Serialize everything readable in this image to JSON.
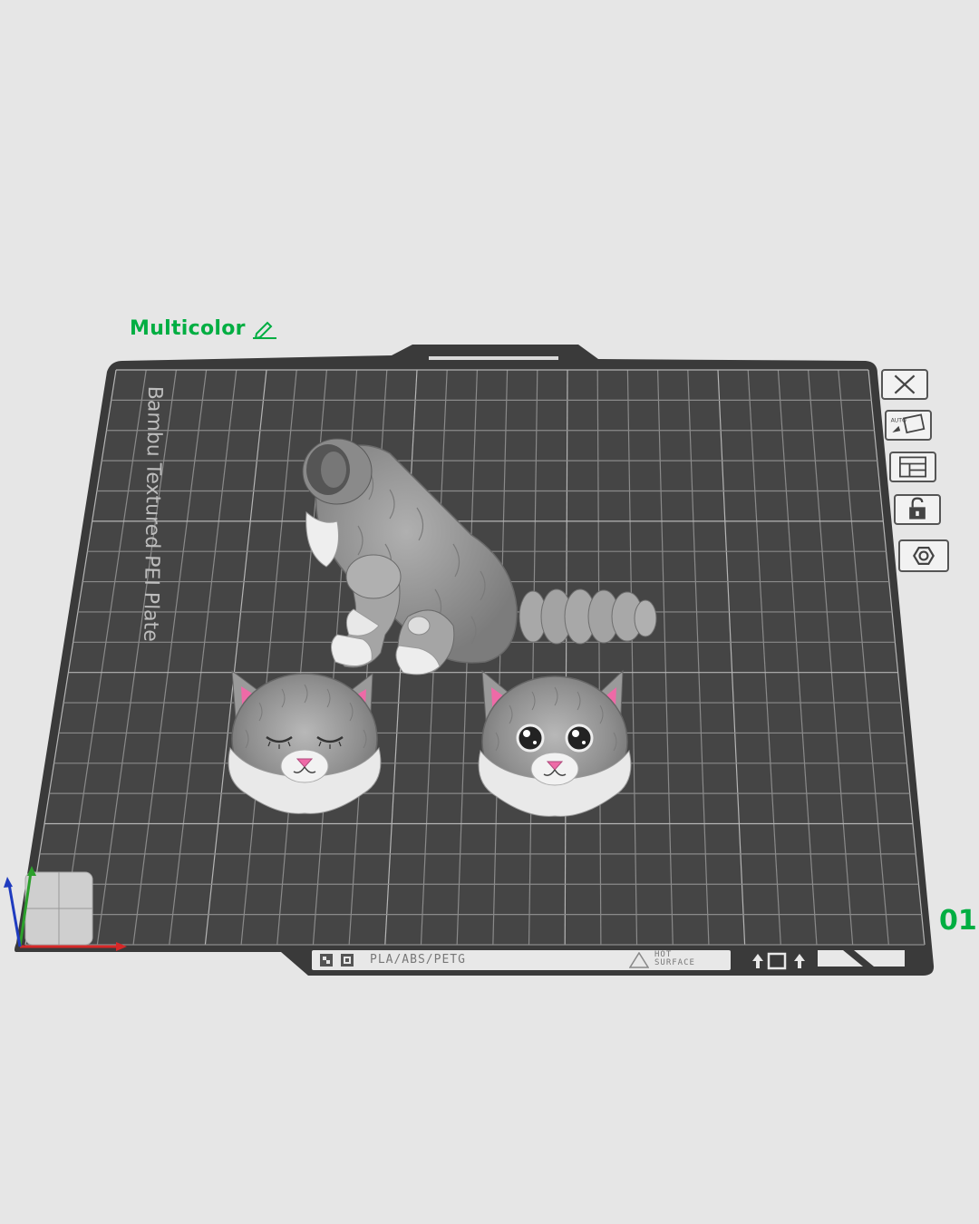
{
  "plate": {
    "name": "Multicolor",
    "index": "01",
    "bed_label": "Bambu Textured PEI Plate",
    "filament_label": "PLA/ABS/PETG",
    "hot_surface_label": "HOT SURFACE"
  },
  "toolbar": {
    "buttons": [
      "delete-icon",
      "auto-orient-icon",
      "arrange-icon",
      "lock-icon",
      "settings-icon"
    ]
  },
  "colors": {
    "accent": "#00ae42",
    "bed": "#454545",
    "bed_border": "#3a3a3a",
    "grid": "#8e8e8e",
    "model": "#9a9a9a",
    "ear_pink": "#ee6aa7",
    "background": "#e6e6e6",
    "axis_x": "#d62828",
    "axis_y": "#2ca02c",
    "axis_z": "#1f3bbf"
  }
}
